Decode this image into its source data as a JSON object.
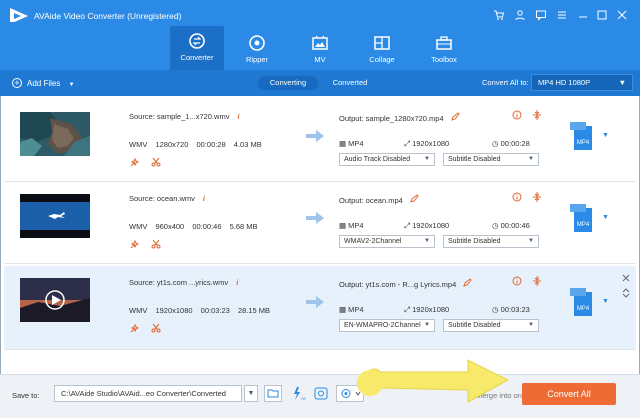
{
  "app": {
    "title": "AVAide Video Converter (Unregistered)"
  },
  "nav": {
    "items": [
      {
        "label": "Converter",
        "icon": "converter-icon",
        "active": true
      },
      {
        "label": "Ripper",
        "icon": "ripper-icon",
        "active": false
      },
      {
        "label": "MV",
        "icon": "mv-icon",
        "active": false
      },
      {
        "label": "Collage",
        "icon": "collage-icon",
        "active": false
      },
      {
        "label": "Toolbox",
        "icon": "toolbox-icon",
        "active": false
      }
    ]
  },
  "toolbar": {
    "add_files": "Add Files",
    "tab_converting": "Converting",
    "tab_converted": "Converted",
    "convert_all_to": "Convert All to:",
    "format": "MP4 HD 1080P"
  },
  "files": [
    {
      "source": "Source: sample_1...x720.wmv",
      "format": "WMV",
      "resolution": "1280x720",
      "duration": "00:00:28",
      "size": "4.03 MB",
      "output": "Output: sample_1280x720.mp4",
      "out_format": "MP4",
      "out_resolution": "1920x1080",
      "out_duration": "00:00:28",
      "audio": "Audio Track Disabled",
      "subtitle": "Subtitle Disabled",
      "badge": "MP4"
    },
    {
      "source": "Source: ocean.wmv",
      "format": "WMV",
      "resolution": "960x400",
      "duration": "00:00:46",
      "size": "5.68 MB",
      "output": "Output: ocean.mp4",
      "out_format": "MP4",
      "out_resolution": "1920x1080",
      "out_duration": "00:00:46",
      "audio": "WMAV2-2Channel",
      "subtitle": "Subtitle Disabled",
      "badge": "MP4"
    },
    {
      "source": "Source: yt1s.com ...yrics.wmv",
      "format": "WMV",
      "resolution": "1920x1080",
      "duration": "00:03:23",
      "size": "28.15 MB",
      "output": "Output: yt1s.com - R...g Lyrics.mp4",
      "out_format": "MP4",
      "out_resolution": "1920x1080",
      "out_duration": "00:03:23",
      "audio": "EN-WMAPRO-2Channel",
      "subtitle": "Subtitle Disabled",
      "badge": "MP4"
    }
  ],
  "bottom": {
    "save_to": "Save to:",
    "path": "C:\\AVAide Studio\\AVAid...eo Converter\\Converted",
    "merge": "Merge into one file",
    "convert_all": "Convert All"
  },
  "colors": {
    "header": "#2a8ae6",
    "subbar": "#1f78d1",
    "accent": "#ee6b35",
    "pointer": "#f7ea6a"
  }
}
